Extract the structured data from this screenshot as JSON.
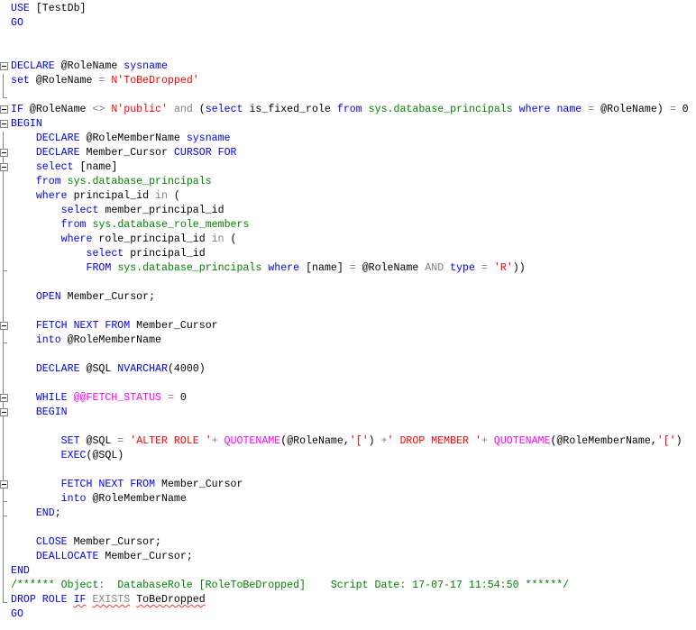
{
  "app": {
    "name": "SQL query editor"
  },
  "palette": {
    "background": "#ffffff",
    "keyword": "#0000f0",
    "identifier": "#000000",
    "operator": "#808080",
    "string": "#ff0000",
    "system_table": "#008000",
    "comment": "#008000",
    "system_function": "#ff00ff",
    "fold_line": "#848484",
    "error_squiggle": "#ff3333"
  },
  "editor": {
    "lines": [
      {
        "gutter": "none",
        "segments": [
          {
            "t": "kw",
            "x": "USE"
          },
          {
            "t": "id",
            "x": " [TestDb]"
          }
        ]
      },
      {
        "gutter": "none",
        "segments": [
          {
            "t": "kw",
            "x": "GO"
          }
        ]
      },
      {
        "gutter": "none",
        "segments": []
      },
      {
        "gutter": "none",
        "segments": []
      },
      {
        "gutter": "box",
        "segments": [
          {
            "t": "kw",
            "x": "DECLARE"
          },
          {
            "t": "id",
            "x": " @RoleName "
          },
          {
            "t": "kw",
            "x": "sysname"
          }
        ]
      },
      {
        "gutter": "line",
        "segments": [
          {
            "t": "kw",
            "x": "set"
          },
          {
            "t": "id",
            "x": " @RoleName "
          },
          {
            "t": "op",
            "x": "="
          },
          {
            "t": "id",
            "x": " "
          },
          {
            "t": "str",
            "x": "N'ToBeDropped'"
          }
        ]
      },
      {
        "gutter": "corner",
        "segments": []
      },
      {
        "gutter": "box",
        "segments": [
          {
            "t": "kw",
            "x": "IF"
          },
          {
            "t": "id",
            "x": " @RoleName "
          },
          {
            "t": "op",
            "x": "<>"
          },
          {
            "t": "id",
            "x": " "
          },
          {
            "t": "str",
            "x": "N'public'"
          },
          {
            "t": "id",
            "x": " "
          },
          {
            "t": "op",
            "x": "and"
          },
          {
            "t": "id",
            "x": " ("
          },
          {
            "t": "kw",
            "x": "select"
          },
          {
            "t": "id",
            "x": " is_fixed_role "
          },
          {
            "t": "kw",
            "x": "from"
          },
          {
            "t": "id",
            "x": " "
          },
          {
            "t": "tbl",
            "x": "sys.database_principals"
          },
          {
            "t": "id",
            "x": " "
          },
          {
            "t": "kw",
            "x": "where"
          },
          {
            "t": "id",
            "x": " "
          },
          {
            "t": "kw",
            "x": "name"
          },
          {
            "t": "id",
            "x": " "
          },
          {
            "t": "op",
            "x": "="
          },
          {
            "t": "id",
            "x": " @RoleName) "
          },
          {
            "t": "op",
            "x": "="
          },
          {
            "t": "id",
            "x": " 0"
          }
        ]
      },
      {
        "gutter": "box",
        "segments": [
          {
            "t": "kw",
            "x": "BEGIN"
          }
        ]
      },
      {
        "gutter": "line",
        "segments": [
          {
            "t": "id",
            "x": "    "
          },
          {
            "t": "kw",
            "x": "DECLARE"
          },
          {
            "t": "id",
            "x": " @RoleMemberName "
          },
          {
            "t": "kw",
            "x": "sysname"
          }
        ]
      },
      {
        "gutter": "box-line",
        "segments": [
          {
            "t": "id",
            "x": "    "
          },
          {
            "t": "kw",
            "x": "DECLARE"
          },
          {
            "t": "id",
            "x": " Member_Cursor "
          },
          {
            "t": "kw",
            "x": "CURSOR FOR"
          }
        ]
      },
      {
        "gutter": "box-line",
        "segments": [
          {
            "t": "id",
            "x": "    "
          },
          {
            "t": "kw",
            "x": "select"
          },
          {
            "t": "id",
            "x": " [name]"
          }
        ]
      },
      {
        "gutter": "line",
        "segments": [
          {
            "t": "id",
            "x": "    "
          },
          {
            "t": "kw",
            "x": "from"
          },
          {
            "t": "id",
            "x": " "
          },
          {
            "t": "tbl",
            "x": "sys.database_principals"
          }
        ]
      },
      {
        "gutter": "line",
        "segments": [
          {
            "t": "id",
            "x": "    "
          },
          {
            "t": "kw",
            "x": "where"
          },
          {
            "t": "id",
            "x": " principal_id "
          },
          {
            "t": "op",
            "x": "in"
          },
          {
            "t": "id",
            "x": " ("
          }
        ]
      },
      {
        "gutter": "line",
        "segments": [
          {
            "t": "id",
            "x": "        "
          },
          {
            "t": "kw",
            "x": "select"
          },
          {
            "t": "id",
            "x": " member_principal_id"
          }
        ]
      },
      {
        "gutter": "line",
        "segments": [
          {
            "t": "id",
            "x": "        "
          },
          {
            "t": "kw",
            "x": "from"
          },
          {
            "t": "id",
            "x": " "
          },
          {
            "t": "tbl",
            "x": "sys.database_role_members"
          }
        ]
      },
      {
        "gutter": "line",
        "segments": [
          {
            "t": "id",
            "x": "        "
          },
          {
            "t": "kw",
            "x": "where"
          },
          {
            "t": "id",
            "x": " role_principal_id "
          },
          {
            "t": "op",
            "x": "in"
          },
          {
            "t": "id",
            "x": " ("
          }
        ]
      },
      {
        "gutter": "line",
        "segments": [
          {
            "t": "id",
            "x": "            "
          },
          {
            "t": "kw",
            "x": "select"
          },
          {
            "t": "id",
            "x": " principal_id"
          }
        ]
      },
      {
        "gutter": "corner-line",
        "segments": [
          {
            "t": "id",
            "x": "            "
          },
          {
            "t": "kw",
            "x": "FROM"
          },
          {
            "t": "id",
            "x": " "
          },
          {
            "t": "tbl",
            "x": "sys.database_principals"
          },
          {
            "t": "id",
            "x": " "
          },
          {
            "t": "kw",
            "x": "where"
          },
          {
            "t": "id",
            "x": " [name] "
          },
          {
            "t": "op",
            "x": "="
          },
          {
            "t": "id",
            "x": " @RoleName "
          },
          {
            "t": "op",
            "x": "AND"
          },
          {
            "t": "id",
            "x": " "
          },
          {
            "t": "kw",
            "x": "type"
          },
          {
            "t": "id",
            "x": " "
          },
          {
            "t": "op",
            "x": "="
          },
          {
            "t": "id",
            "x": " "
          },
          {
            "t": "str",
            "x": "'R'"
          },
          {
            "t": "id",
            "x": "))"
          }
        ]
      },
      {
        "gutter": "line",
        "segments": []
      },
      {
        "gutter": "line",
        "segments": [
          {
            "t": "id",
            "x": "    "
          },
          {
            "t": "kw",
            "x": "OPEN"
          },
          {
            "t": "id",
            "x": " Member_Cursor;"
          }
        ]
      },
      {
        "gutter": "line",
        "segments": []
      },
      {
        "gutter": "box-line",
        "segments": [
          {
            "t": "id",
            "x": "    "
          },
          {
            "t": "kw",
            "x": "FETCH NEXT FROM"
          },
          {
            "t": "id",
            "x": " Member_Cursor"
          }
        ]
      },
      {
        "gutter": "corner-line",
        "segments": [
          {
            "t": "id",
            "x": "    "
          },
          {
            "t": "kw",
            "x": "into"
          },
          {
            "t": "id",
            "x": " @RoleMemberName"
          }
        ]
      },
      {
        "gutter": "line",
        "segments": []
      },
      {
        "gutter": "line",
        "segments": [
          {
            "t": "id",
            "x": "    "
          },
          {
            "t": "kw",
            "x": "DECLARE"
          },
          {
            "t": "id",
            "x": " @SQL "
          },
          {
            "t": "kw",
            "x": "NVARCHAR"
          },
          {
            "t": "id",
            "x": "(4000)"
          }
        ]
      },
      {
        "gutter": "line",
        "segments": []
      },
      {
        "gutter": "box-line",
        "segments": [
          {
            "t": "id",
            "x": "    "
          },
          {
            "t": "kw",
            "x": "WHILE"
          },
          {
            "t": "id",
            "x": " "
          },
          {
            "t": "fn",
            "x": "@@FETCH_STATUS"
          },
          {
            "t": "id",
            "x": " "
          },
          {
            "t": "op",
            "x": "="
          },
          {
            "t": "id",
            "x": " 0"
          }
        ]
      },
      {
        "gutter": "box-line",
        "segments": [
          {
            "t": "id",
            "x": "    "
          },
          {
            "t": "kw",
            "x": "BEGIN"
          }
        ]
      },
      {
        "gutter": "line",
        "segments": []
      },
      {
        "gutter": "line",
        "segments": [
          {
            "t": "id",
            "x": "        "
          },
          {
            "t": "kw",
            "x": "SET"
          },
          {
            "t": "id",
            "x": " @SQL "
          },
          {
            "t": "op",
            "x": "="
          },
          {
            "t": "id",
            "x": " "
          },
          {
            "t": "str",
            "x": "'ALTER ROLE '"
          },
          {
            "t": "op",
            "x": "+"
          },
          {
            "t": "id",
            "x": " "
          },
          {
            "t": "fn",
            "x": "QUOTENAME"
          },
          {
            "t": "id",
            "x": "(@RoleName,"
          },
          {
            "t": "str",
            "x": "'['"
          },
          {
            "t": "id",
            "x": ") "
          },
          {
            "t": "op",
            "x": "+"
          },
          {
            "t": "str",
            "x": "' DROP MEMBER '"
          },
          {
            "t": "op",
            "x": "+"
          },
          {
            "t": "id",
            "x": " "
          },
          {
            "t": "fn",
            "x": "QUOTENAME"
          },
          {
            "t": "id",
            "x": "(@RoleMemberName,"
          },
          {
            "t": "str",
            "x": "'['"
          },
          {
            "t": "id",
            "x": ")"
          }
        ]
      },
      {
        "gutter": "line",
        "segments": [
          {
            "t": "id",
            "x": "        "
          },
          {
            "t": "kw",
            "x": "EXEC"
          },
          {
            "t": "id",
            "x": "(@SQL)"
          }
        ]
      },
      {
        "gutter": "line",
        "segments": []
      },
      {
        "gutter": "box-line",
        "segments": [
          {
            "t": "id",
            "x": "        "
          },
          {
            "t": "kw",
            "x": "FETCH NEXT FROM"
          },
          {
            "t": "id",
            "x": " Member_Cursor"
          }
        ]
      },
      {
        "gutter": "corner-line",
        "segments": [
          {
            "t": "id",
            "x": "        "
          },
          {
            "t": "kw",
            "x": "into"
          },
          {
            "t": "id",
            "x": " @RoleMemberName"
          }
        ]
      },
      {
        "gutter": "corner-line",
        "segments": [
          {
            "t": "id",
            "x": "    "
          },
          {
            "t": "kw",
            "x": "END"
          },
          {
            "t": "id",
            "x": ";"
          }
        ]
      },
      {
        "gutter": "line",
        "segments": []
      },
      {
        "gutter": "line",
        "segments": [
          {
            "t": "id",
            "x": "    "
          },
          {
            "t": "kw",
            "x": "CLOSE"
          },
          {
            "t": "id",
            "x": " Member_Cursor;"
          }
        ]
      },
      {
        "gutter": "line",
        "segments": [
          {
            "t": "id",
            "x": "    "
          },
          {
            "t": "kw",
            "x": "DEALLOCATE"
          },
          {
            "t": "id",
            "x": " Member_Cursor;"
          }
        ]
      },
      {
        "gutter": "line",
        "segments": [
          {
            "t": "kw",
            "x": "END"
          }
        ]
      },
      {
        "gutter": "line",
        "segments": [
          {
            "t": "cmt",
            "x": "/****** Object:  DatabaseRole [RoleToBeDropped]    Script Date: 17-07-17 11:54:50 ******/"
          }
        ]
      },
      {
        "gutter": "corner",
        "segments": [
          {
            "t": "kw",
            "x": "DROP ROLE "
          },
          {
            "t": "kw",
            "x": "IF",
            "err": true
          },
          {
            "t": "id",
            "x": " "
          },
          {
            "t": "op",
            "x": "EXISTS",
            "err": true
          },
          {
            "t": "id",
            "x": " "
          },
          {
            "t": "id",
            "x": "ToBeDropped",
            "err": true
          }
        ]
      },
      {
        "gutter": "none",
        "segments": [
          {
            "t": "kw",
            "x": "GO"
          }
        ]
      }
    ]
  }
}
